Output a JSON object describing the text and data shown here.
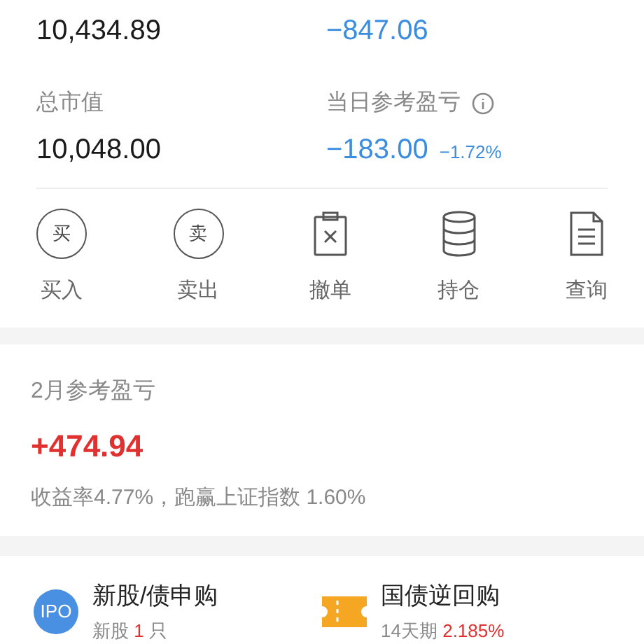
{
  "top_row": [
    {
      "value": "10,434.89",
      "color": "#1a1a1a"
    },
    {
      "value": "−847.06",
      "color": "#3b8de0"
    }
  ],
  "summary": [
    {
      "label": "总市值",
      "value": "10,048.00",
      "color": "#1a1a1a",
      "info": false
    },
    {
      "label": "当日参考盈亏",
      "value": "−183.00",
      "change": "−1.72%",
      "color": "#3b8de0",
      "info": true
    }
  ],
  "actions": [
    {
      "label": "买入",
      "kind": "circle",
      "glyph": "买"
    },
    {
      "label": "卖出",
      "kind": "circle",
      "glyph": "卖"
    },
    {
      "label": "撤单",
      "kind": "cancel"
    },
    {
      "label": "持仓",
      "kind": "stack"
    },
    {
      "label": "查询",
      "kind": "document"
    }
  ],
  "monthly": {
    "title": "2月参考盈亏",
    "value": "+474.94",
    "color": "#e0302f",
    "note": "收益率4.77%，跑赢上证指数 1.60%"
  },
  "services": [
    {
      "kind": "ipo",
      "badge": "IPO",
      "title": "新股/债申购",
      "sub": "新股",
      "highlight": "1",
      "suffix": "只"
    },
    {
      "kind": "ticket",
      "title": "国债逆回购",
      "sub": "14天期",
      "highlight": "2.185%"
    }
  ]
}
